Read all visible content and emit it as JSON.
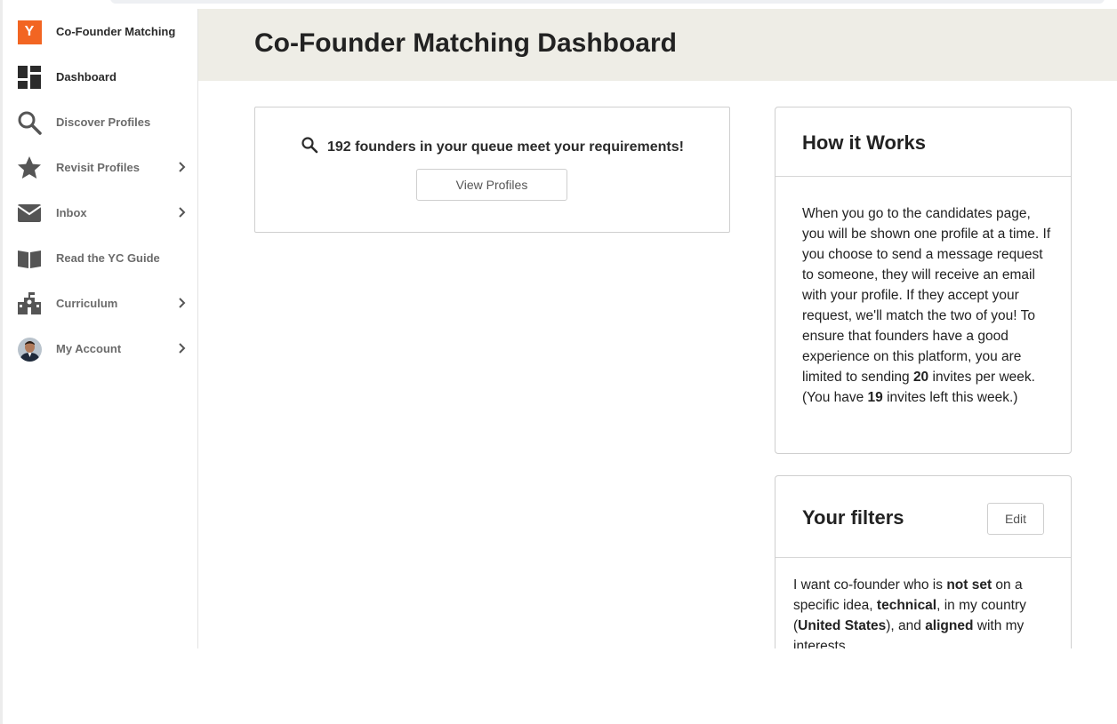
{
  "sidebar": {
    "brand": {
      "logo_letter": "Y",
      "label": "Co-Founder Matching"
    },
    "items": [
      {
        "label": "Dashboard",
        "icon": "dashboard-icon",
        "active": true,
        "expandable": false
      },
      {
        "label": "Discover Profiles",
        "icon": "search-icon",
        "active": false,
        "expandable": false
      },
      {
        "label": "Revisit Profiles",
        "icon": "star-icon",
        "active": false,
        "expandable": true
      },
      {
        "label": "Inbox",
        "icon": "envelope-icon",
        "active": false,
        "expandable": true
      },
      {
        "label": "Read the YC Guide",
        "icon": "book-icon",
        "active": false,
        "expandable": false
      },
      {
        "label": "Curriculum",
        "icon": "school-icon",
        "active": false,
        "expandable": true
      },
      {
        "label": "My Account",
        "icon": "avatar",
        "active": false,
        "expandable": true
      }
    ]
  },
  "header": {
    "title": "Co-Founder Matching Dashboard"
  },
  "queue": {
    "text": "192 founders in your queue meet your requirements!",
    "button_label": "View Profiles"
  },
  "how_it_works": {
    "title": "How it Works",
    "body_part1": "When you go to the candidates page, you will be shown one profile at a time. If you choose to send a message request to someone, they will receive an email with your profile. If they accept your request, we'll match the two of you! To ensure that founders have a good experience on this platform, you are limited to sending ",
    "weekly_limit": "20",
    "body_part2": " invites per week. (You have ",
    "invites_left": "19",
    "body_part3": " invites left this week.)"
  },
  "filters": {
    "title": "Your filters",
    "edit_label": "Edit",
    "text_1": "I want co-founder who is ",
    "idea": "not set",
    "text_2": " on a specific idea, ",
    "technical": "technical",
    "text_3": ", in my country (",
    "country": "United States",
    "text_4": "), and ",
    "interests": "aligned",
    "text_5": " with my interests."
  },
  "colors": {
    "brand_orange": "#f26522",
    "header_band": "#eeede6",
    "border": "#cfcfcf"
  }
}
